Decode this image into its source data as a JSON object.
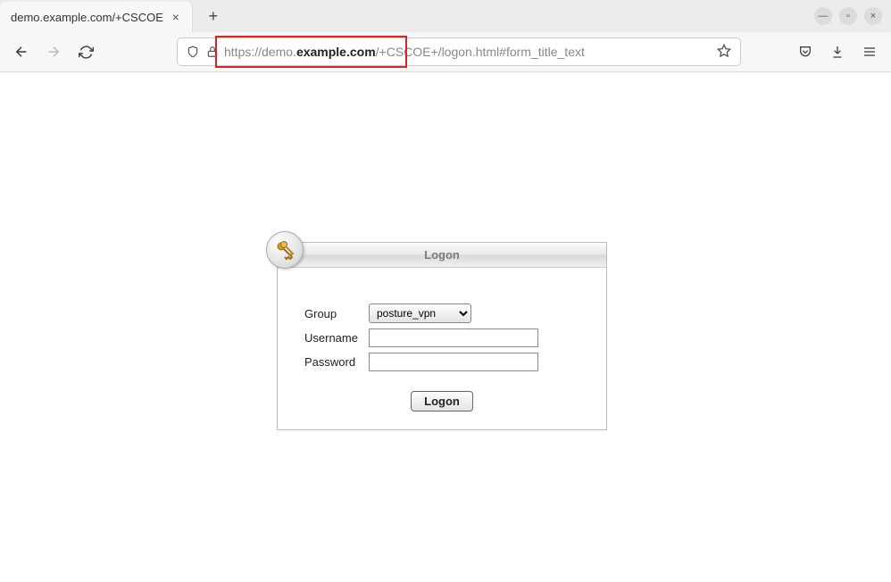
{
  "browser": {
    "tab_title": "demo.example.com/+CSCOE",
    "url_scheme": "https://demo.",
    "url_domain": "example.com",
    "url_path": "/+CSCOE+/logon.html#form_title_text"
  },
  "panel": {
    "title": "Logon",
    "group_label": "Group",
    "group_value": "posture_vpn",
    "username_label": "Username",
    "username_value": "",
    "password_label": "Password",
    "password_value": "",
    "submit_label": "Logon"
  }
}
